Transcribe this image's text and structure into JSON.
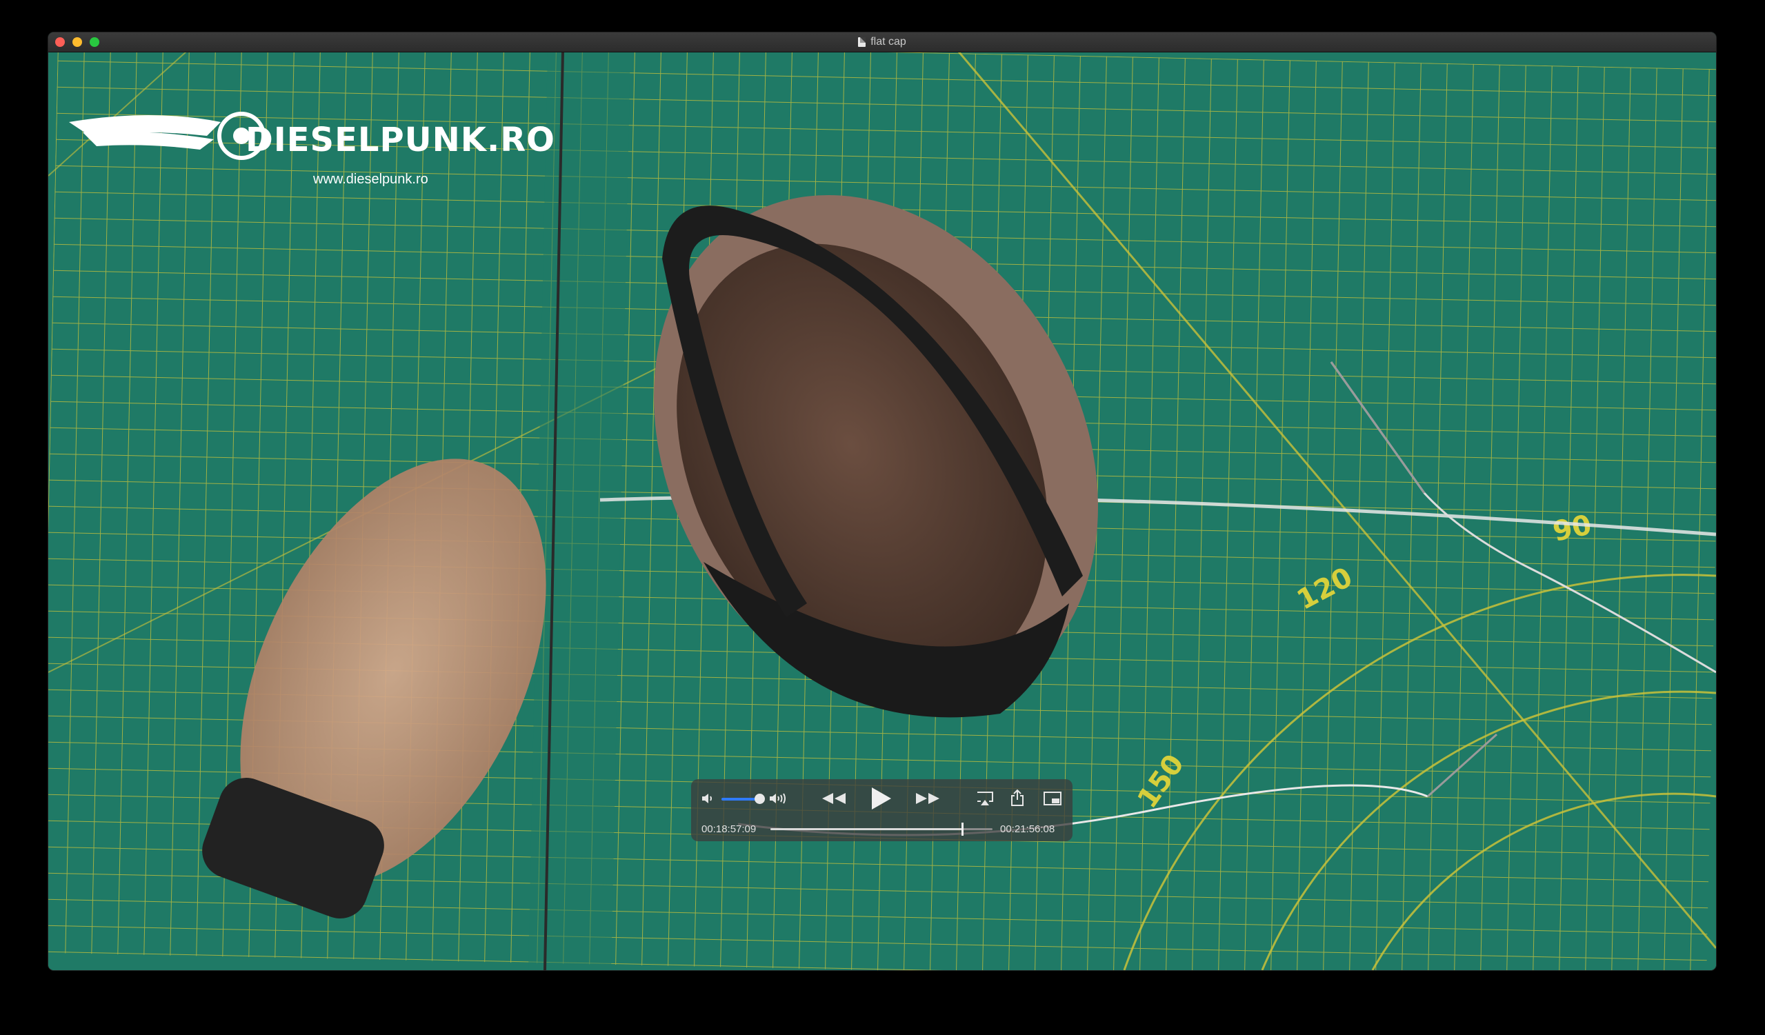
{
  "window": {
    "title": "flat cap"
  },
  "overlay": {
    "logo_text": "DIESELPUNK.RO",
    "logo_url": "www.dieselpunk.ro"
  },
  "mat": {
    "angle_labels": [
      "90",
      "120",
      "150"
    ]
  },
  "player": {
    "elapsed": "00:18:57:09",
    "total": "00:21:56:08",
    "progress": 0.864,
    "volume": 0.85,
    "controls": [
      "volume-low-icon",
      "volume-high-icon",
      "rewind-icon",
      "play-icon",
      "fast-forward-icon",
      "airplay-icon",
      "share-icon",
      "picture-in-picture-icon"
    ]
  },
  "colors": {
    "mat_green": "#1f7a66",
    "grid_yellow": "#c9c23a",
    "cap_brown": "#5a4035",
    "cap_black": "#1a1a1a",
    "accent_blue": "#2f7bff"
  }
}
